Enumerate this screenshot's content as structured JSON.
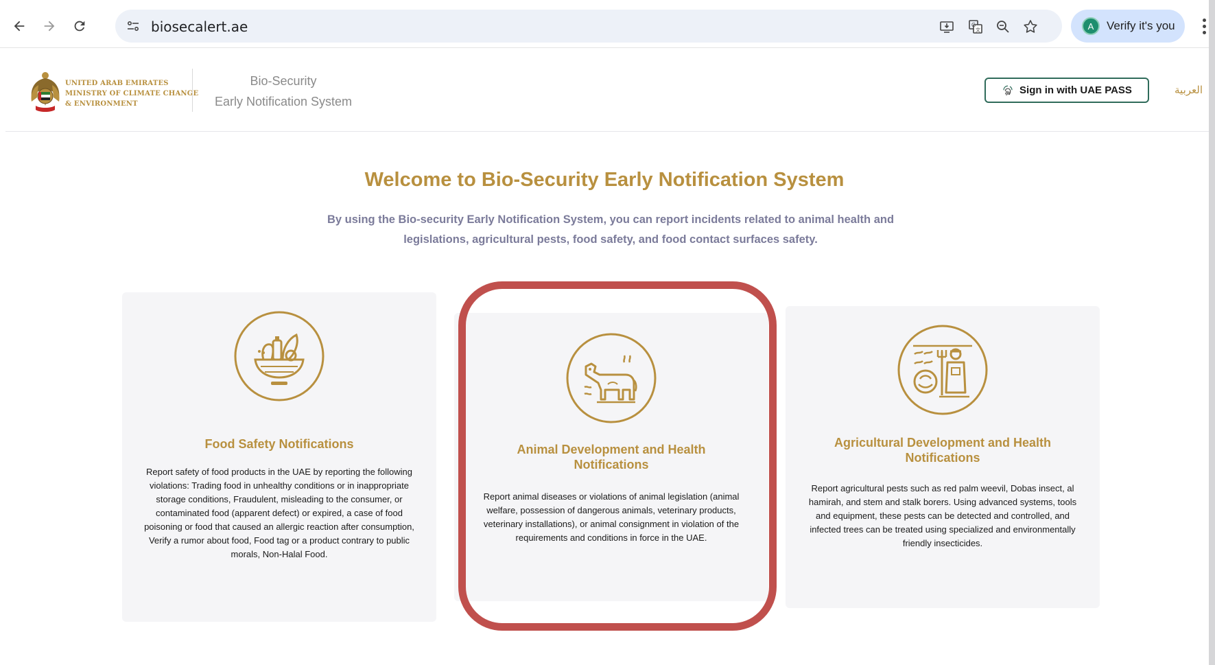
{
  "browser": {
    "url": "biosecalert.ae",
    "verify_label": "Verify it's you",
    "avatar_letter": "A"
  },
  "header": {
    "ministry_lines": [
      "UNITED ARAB EMIRATES",
      "MINISTRY OF CLIMATE CHANGE",
      "& ENVIRONMENT"
    ],
    "system_title_line1": "Bio-Security",
    "system_title_line2": "Early Notification System",
    "signin_label": "Sign in with UAE PASS",
    "language_link": "العربية"
  },
  "hero": {
    "title": "Welcome to Bio-Security Early Notification System",
    "subtitle": "By using the Bio-security Early Notification System, you can report incidents related to animal health and legislations, agricultural pests, food safety, and food contact surfaces safety."
  },
  "cards": [
    {
      "title": "Food Safety Notifications",
      "description": "Report safety of food products in the UAE by reporting the following violations: Trading food in unhealthy conditions or in inappropriate storage conditions, Fraudulent, misleading to the consumer, or contaminated food (apparent defect) or expired, a case of food poisoning or food that caused an allergic reaction after consumption, Verify a rumor about food, Food tag or a product contrary to public morals, Non-Halal Food.",
      "icon": "food-basket-icon"
    },
    {
      "title": "Animal Development and Health Notifications",
      "description": "Report animal diseases or violations of animal legislation (animal welfare, possession of dangerous animals, veterinary products, veterinary installations), or animal consignment in violation of the requirements and conditions in force in the UAE.",
      "icon": "cow-icon"
    },
    {
      "title": "Agricultural Development and Health Notifications",
      "description": "Report agricultural pests such as red palm weevil, Dobas insect, al hamirah, and stem and stalk borers. Using advanced systems, tools and equipment, these pests can be detected and controlled, and infected trees can be treated using specialized and environmentally friendly insecticides.",
      "icon": "farmer-icon"
    }
  ],
  "colors": {
    "gold": "#b8903f",
    "highlight_red": "#c0504d",
    "card_bg": "#f5f5f7",
    "uaepass_border": "#2f6b5a"
  }
}
